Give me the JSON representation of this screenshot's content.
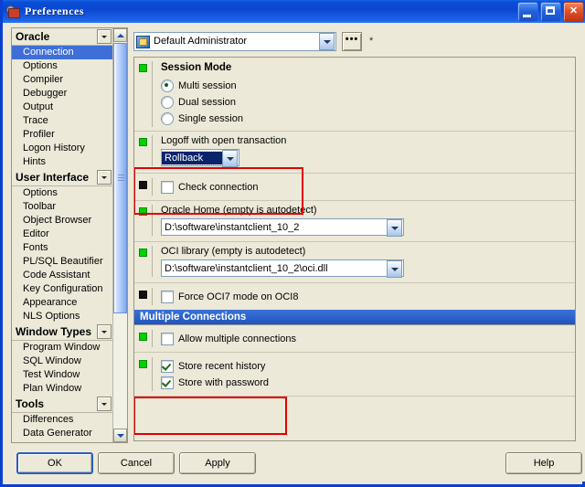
{
  "window": {
    "title": "Preferences",
    "icon": "preferences-icon",
    "minimize_label": "",
    "maximize_label": "",
    "close_label": "✕"
  },
  "sidebar": {
    "groups": [
      {
        "label": "Oracle",
        "items": [
          {
            "label": "Connection",
            "selected": true
          },
          {
            "label": "Options",
            "selected": false
          },
          {
            "label": "Compiler",
            "selected": false
          },
          {
            "label": "Debugger",
            "selected": false
          },
          {
            "label": "Output",
            "selected": false
          },
          {
            "label": "Trace",
            "selected": false
          },
          {
            "label": "Profiler",
            "selected": false
          },
          {
            "label": "Logon History",
            "selected": false
          },
          {
            "label": "Hints",
            "selected": false
          }
        ]
      },
      {
        "label": "User Interface",
        "items": [
          {
            "label": "Options",
            "selected": false
          },
          {
            "label": "Toolbar",
            "selected": false
          },
          {
            "label": "Object Browser",
            "selected": false
          },
          {
            "label": "Editor",
            "selected": false
          },
          {
            "label": "Fonts",
            "selected": false
          },
          {
            "label": "PL/SQL Beautifier",
            "selected": false
          },
          {
            "label": "Code Assistant",
            "selected": false
          },
          {
            "label": "Key Configuration",
            "selected": false
          },
          {
            "label": "Appearance",
            "selected": false
          },
          {
            "label": "NLS Options",
            "selected": false
          }
        ]
      },
      {
        "label": "Window Types",
        "items": [
          {
            "label": "Program Window",
            "selected": false
          },
          {
            "label": "SQL Window",
            "selected": false
          },
          {
            "label": "Test Window",
            "selected": false
          },
          {
            "label": "Plan Window",
            "selected": false
          }
        ]
      },
      {
        "label": "Tools",
        "items": [
          {
            "label": "Differences",
            "selected": false
          },
          {
            "label": "Data Generator",
            "selected": false
          }
        ]
      }
    ]
  },
  "profile": {
    "name": "Default Administrator",
    "browse_label": "•••",
    "dirty_mark": "*"
  },
  "options": {
    "session_mode": {
      "title": "Session Mode",
      "choices": [
        {
          "label": "Multi session",
          "checked": true
        },
        {
          "label": "Dual session",
          "checked": false
        },
        {
          "label": "Single session",
          "checked": false
        }
      ]
    },
    "logoff": {
      "label": "Logoff with open transaction",
      "value": "Rollback"
    },
    "check_connection": {
      "label": "Check connection",
      "checked": false
    },
    "oracle_home": {
      "label": "Oracle Home (empty is autodetect)",
      "value": "D:\\software\\instantclient_10_2"
    },
    "oci_library": {
      "label": "OCI library (empty is autodetect)",
      "value": "D:\\software\\instantclient_10_2\\oci.dll"
    },
    "force_oci7": {
      "label": "Force OCI7 mode on OCI8",
      "checked": false
    },
    "multiple_connections": {
      "header": "Multiple Connections",
      "allow": {
        "label": "Allow multiple connections",
        "checked": false
      },
      "store_history": {
        "label": "Store recent history",
        "checked": true
      },
      "store_password": {
        "label": "Store with password",
        "checked": true
      }
    }
  },
  "footer": {
    "ok": "OK",
    "cancel": "Cancel",
    "apply": "Apply",
    "help": "Help"
  },
  "colors": {
    "accent": "#0a3fd1",
    "selection": "#3f6fd6",
    "header_bar": "#1f54bd",
    "annotation": "#e00000",
    "marker_green": "#00d200"
  }
}
